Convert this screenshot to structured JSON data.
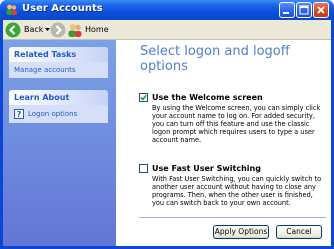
{
  "window": {
    "title": "User Accounts"
  },
  "toolbar": {
    "back_label": "Back",
    "home_label": "Home"
  },
  "sidebar": {
    "related_tasks": {
      "header": "Related Tasks",
      "items": [
        {
          "label": "Manage accounts"
        }
      ]
    },
    "learn_about": {
      "header": "Learn About",
      "items": [
        {
          "label": "Logon options",
          "icon": "help-icon"
        }
      ]
    }
  },
  "main": {
    "title": "Select logon and logoff options",
    "welcome": {
      "label": "Use the Welcome screen",
      "checked": true,
      "description": "By using the Welcome screen, you can simply click your account name to log on. For added security, you can turn off this feature and use the classic logon prompt which requires users to type a user account name."
    },
    "fast_switch": {
      "label": "Use Fast User Switching",
      "checked": false,
      "description": "With Fast User Switching, you can quickly switch to another user account without having to close any programs. Then, when the other user is finished, you can switch back to your own account."
    },
    "apply_label": "Apply Options",
    "cancel_label": "Cancel"
  },
  "colors": {
    "title_bar": "#0b4fdc",
    "link": "#215dc6",
    "heading": "#4f7fca",
    "sidebar_bg": "#6f8fdf"
  }
}
